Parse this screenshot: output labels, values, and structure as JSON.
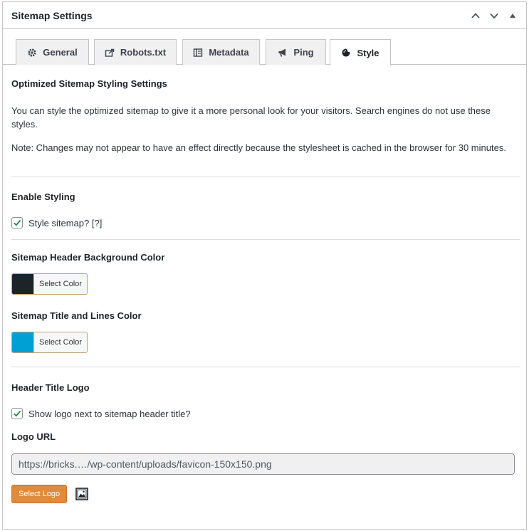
{
  "panel": {
    "title": "Sitemap Settings",
    "controls": [
      "chevron-up-icon",
      "chevron-down-icon",
      "triangle-up-icon"
    ]
  },
  "tabs": [
    {
      "label": "General",
      "icon": "gear-icon",
      "active": false
    },
    {
      "label": "Robots.txt",
      "icon": "share-icon",
      "active": false
    },
    {
      "label": "Metadata",
      "icon": "book-icon",
      "active": false
    },
    {
      "label": "Ping",
      "icon": "megaphone-icon",
      "active": false
    },
    {
      "label": "Style",
      "icon": "palette-icon",
      "active": true
    }
  ],
  "intro": {
    "title": "Optimized Sitemap Styling Settings",
    "description": "You can style the optimized sitemap to give it a more personal look for your visitors. Search engines do not use these styles.",
    "note": "Note: Changes may not appear to have an effect directly because the stylesheet is cached in the browser for 30 minutes."
  },
  "enable_styling": {
    "title": "Enable Styling",
    "checkbox_label": "Style sitemap? [?]",
    "checked": true
  },
  "header_bg_color": {
    "title": "Sitemap Header Background Color",
    "button_label": "Select Color",
    "color": "#1d2327"
  },
  "title_lines_color": {
    "title": "Sitemap Title and Lines Color",
    "button_label": "Select Color",
    "color": "#00a0d2"
  },
  "header_logo": {
    "title": "Header Title Logo",
    "checkbox_label": "Show logo next to sitemap header title?",
    "checked": true,
    "url_label": "Logo URL",
    "url_value": "https://bricks.…/wp-content/uploads/favicon-150x150.png",
    "select_button": "Select Logo",
    "accent": "#e08a3c"
  },
  "colors": {
    "check": "#1e8c3c",
    "border": "#c3c4c7"
  }
}
